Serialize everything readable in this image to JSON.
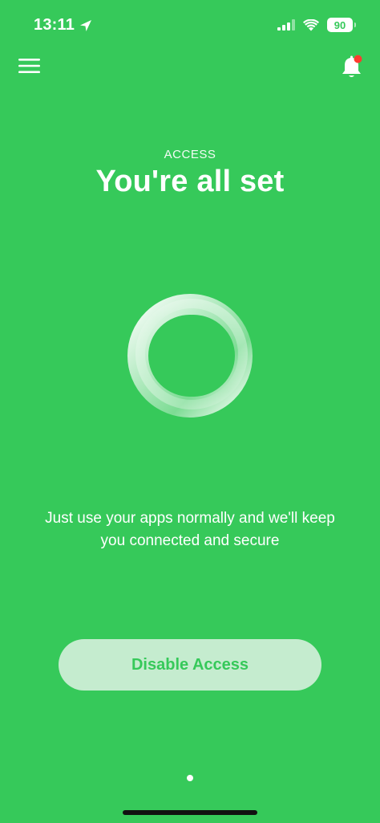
{
  "status_bar": {
    "time": "13:11",
    "battery_level": "90",
    "icons": [
      "location-arrow-icon",
      "cellular-signal-icon",
      "wifi-icon",
      "battery-icon"
    ]
  },
  "header": {
    "menu_icon": "hamburger-menu-icon",
    "notification_icon": "bell-icon",
    "notification_badge_color": "#ff3b30"
  },
  "main": {
    "eyebrow": "ACCESS",
    "title": "You're all set",
    "description": "Just use your apps normally and we'll keep you connected and secure",
    "disable_button_label": "Disable Access"
  },
  "pager": {
    "current_page": 1,
    "total_pages": 1
  },
  "colors": {
    "background": "#36c95a",
    "button_background": "#c5eccf",
    "button_text": "#36c95a",
    "text": "#ffffff"
  }
}
